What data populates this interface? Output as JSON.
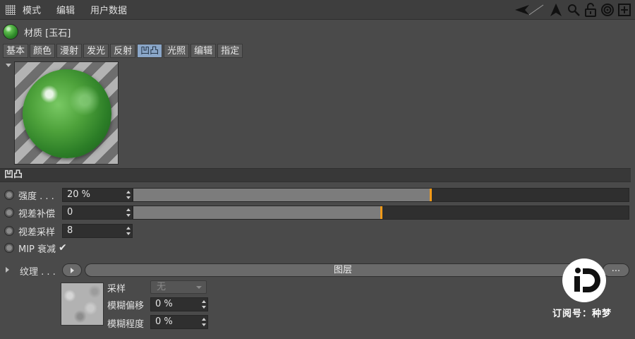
{
  "menubar": {
    "items": [
      "模式",
      "编辑",
      "用户数据"
    ],
    "right_icons": [
      "back-arrow-icon",
      "cursor-arrow-icon",
      "search-icon",
      "lock-icon",
      "target-icon",
      "add-window-icon"
    ]
  },
  "material": {
    "title": "材质 [玉石]",
    "tabs": [
      {
        "label": "基本",
        "active": false
      },
      {
        "label": "颜色",
        "active": false
      },
      {
        "label": "漫射",
        "active": false
      },
      {
        "label": "发光",
        "active": false
      },
      {
        "label": "反射",
        "active": false
      },
      {
        "label": "凹凸",
        "active": true
      },
      {
        "label": "光照",
        "active": false
      },
      {
        "label": "编辑",
        "active": false
      },
      {
        "label": "指定",
        "active": false
      }
    ]
  },
  "section": {
    "title": "凹凸"
  },
  "params": {
    "strength": {
      "label": "强度 . . .",
      "value": "20 %",
      "slider_fraction": 0.6
    },
    "parallax_offset": {
      "label": "视差补偿",
      "value": "0",
      "slider_fraction": 0.5
    },
    "parallax_samples": {
      "label": "视差采样",
      "value": "8"
    },
    "mip_falloff": {
      "label": "MIP 衰减",
      "checked": true,
      "check_glyph": "✔"
    }
  },
  "texture": {
    "label": "纹理 . . .",
    "layer_button": "图层",
    "more_button": "...",
    "sampling_label": "采样",
    "sampling_value": "无",
    "blur_offset_label": "模糊偏移",
    "blur_offset_value": "0 %",
    "blur_scale_label": "模糊程度",
    "blur_scale_value": "0 %"
  },
  "watermark": {
    "text": "订阅号：种梦"
  },
  "colors": {
    "accent_handle": "#f29a18",
    "active_tab": "#8aa6c8",
    "background": "#4a4a4a"
  }
}
